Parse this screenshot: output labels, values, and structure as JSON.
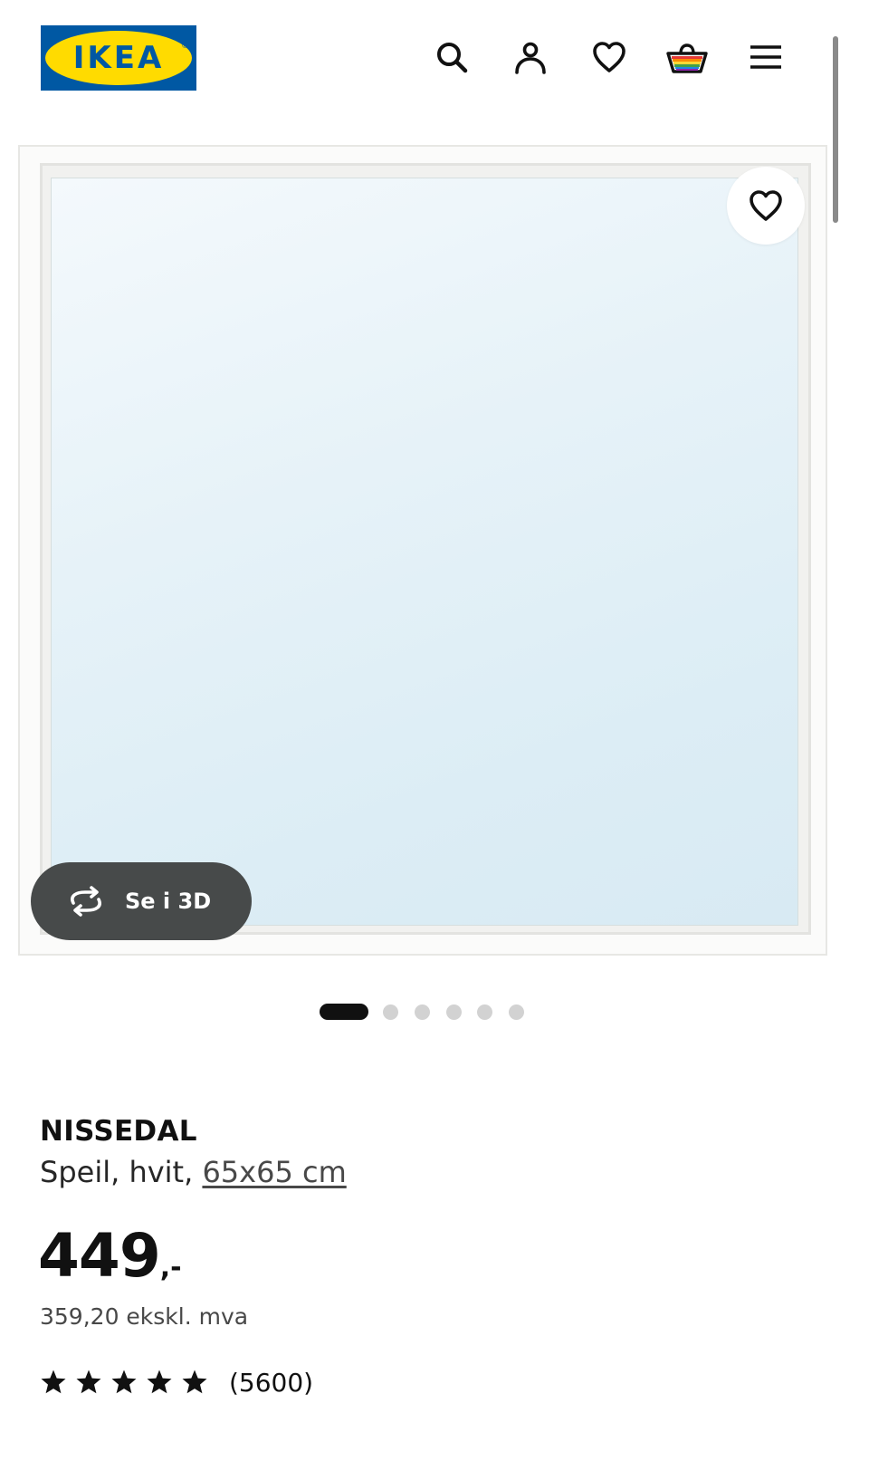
{
  "header": {
    "logo_text": "IKEA",
    "logo_reg": "®",
    "icons": [
      "search-icon",
      "account-icon",
      "favorites-icon",
      "basket-icon",
      "menu-icon"
    ]
  },
  "brand": {
    "blue": "#0058a3",
    "yellow": "#ffdb00"
  },
  "gallery": {
    "view_3d_label": "Se i 3D",
    "total_images": 6,
    "active_index": 0
  },
  "product": {
    "name": "NISSEDAL",
    "description_prefix": "Speil, hvit, ",
    "size": "65x65 cm",
    "price": "449",
    "price_suffix": ",-",
    "price_ex_vat": "359,20 ekskl. mva",
    "rating": 5,
    "rating_max": 5,
    "review_count": "(5600)"
  }
}
